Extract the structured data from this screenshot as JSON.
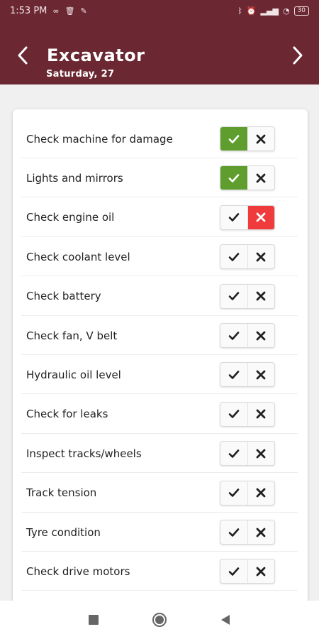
{
  "status_bar": {
    "time": "1:53 PM",
    "battery": "30"
  },
  "header": {
    "title": "Excavator",
    "subtitle": "Saturday,  27"
  },
  "checklist": [
    {
      "label": "Check machine for damage",
      "state": "pass"
    },
    {
      "label": "Lights and mirrors",
      "state": "pass"
    },
    {
      "label": "Check engine oil",
      "state": "fail"
    },
    {
      "label": "Check coolant level",
      "state": "none"
    },
    {
      "label": "Check battery",
      "state": "none"
    },
    {
      "label": "Check fan, V belt",
      "state": "none"
    },
    {
      "label": "Hydraulic oil level",
      "state": "none"
    },
    {
      "label": "Check for leaks",
      "state": "none"
    },
    {
      "label": "Inspect tracks/wheels",
      "state": "none"
    },
    {
      "label": "Track tension",
      "state": "none"
    },
    {
      "label": "Tyre condition",
      "state": "none"
    },
    {
      "label": "Check drive motors",
      "state": "none"
    }
  ],
  "colors": {
    "header_bg": "#6b2833",
    "pass": "#5f9e2e",
    "fail": "#ef3b3b"
  },
  "icons": {
    "prev": "chevron-left-icon",
    "next": "chevron-right-icon",
    "recents": "square-icon",
    "home": "circle-icon",
    "back": "triangle-back-icon"
  }
}
